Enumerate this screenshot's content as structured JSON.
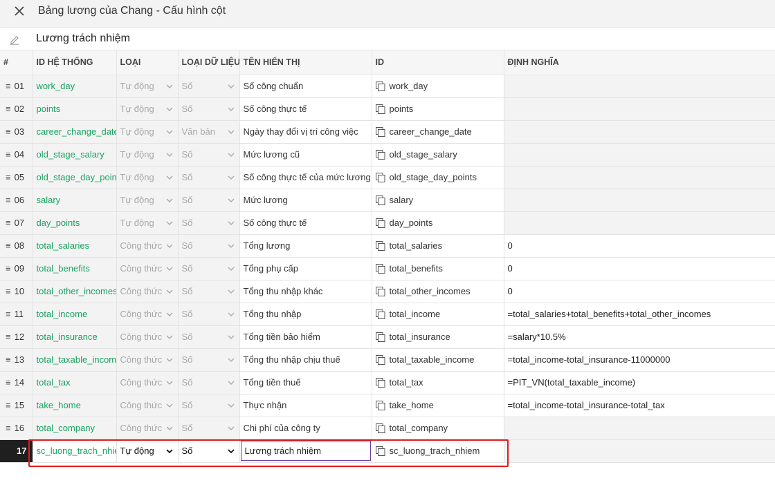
{
  "header": {
    "title": "Bảng lương của Chang - Cấu hình cột",
    "close_icon": "close-icon"
  },
  "name_field": {
    "value": "Lương trách nhiệm",
    "icon": "pencil-icon"
  },
  "columns": {
    "num": "#",
    "system_id": "ID HỆ THỐNG",
    "type": "LOẠI",
    "data_type": "LOẠI DỮ LIỆU",
    "display_name": "TÊN HIỂN THỊ",
    "id": "ID",
    "definition": "ĐỊNH NGHĨA"
  },
  "rows": [
    {
      "num": "01",
      "system_id": "work_day",
      "type": "Tự động",
      "data_type": "Số",
      "display_name": "Số công chuẩn",
      "id": "work_day",
      "definition": ""
    },
    {
      "num": "02",
      "system_id": "points",
      "type": "Tự động",
      "data_type": "Số",
      "display_name": "Số công thực tế",
      "id": "points",
      "definition": ""
    },
    {
      "num": "03",
      "system_id": "career_change_date_",
      "type": "Tự động",
      "data_type": "Văn bản",
      "display_name": "Ngày thay đổi vị trí công việc",
      "id": "career_change_date",
      "definition": ""
    },
    {
      "num": "04",
      "system_id": "old_stage_salary",
      "type": "Tự động",
      "data_type": "Số",
      "display_name": "Mức lương cũ",
      "id": "old_stage_salary",
      "definition": ""
    },
    {
      "num": "05",
      "system_id": "old_stage_day_points",
      "type": "Tự động",
      "data_type": "Số",
      "display_name": "Số công thực tế của mức lương",
      "id": "old_stage_day_points",
      "definition": ""
    },
    {
      "num": "06",
      "system_id": "salary",
      "type": "Tự động",
      "data_type": "Số",
      "display_name": "Mức lương",
      "id": "salary",
      "definition": ""
    },
    {
      "num": "07",
      "system_id": "day_points",
      "type": "Tự động",
      "data_type": "Số",
      "display_name": "Số công thực tế",
      "id": "day_points",
      "definition": ""
    },
    {
      "num": "08",
      "system_id": "total_salaries",
      "type": "Công thức",
      "data_type": "Số",
      "display_name": "Tổng lương",
      "id": "total_salaries",
      "definition": "0"
    },
    {
      "num": "09",
      "system_id": "total_benefits",
      "type": "Công thức",
      "data_type": "Số",
      "display_name": "Tổng phụ cấp",
      "id": "total_benefits",
      "definition": "0"
    },
    {
      "num": "10",
      "system_id": "total_other_incomes",
      "type": "Công thức",
      "data_type": "Số",
      "display_name": "Tổng thu nhập khác",
      "id": "total_other_incomes",
      "definition": "0"
    },
    {
      "num": "11",
      "system_id": "total_income",
      "type": "Công thức",
      "data_type": "Số",
      "display_name": "Tổng thu nhập",
      "id": "total_income",
      "definition": "=total_salaries+total_benefits+total_other_incomes"
    },
    {
      "num": "12",
      "system_id": "total_insurance",
      "type": "Công thức",
      "data_type": "Số",
      "display_name": "Tổng tiền bảo hiểm",
      "id": "total_insurance",
      "definition": "=salary*10.5%"
    },
    {
      "num": "13",
      "system_id": "total_taxable_income",
      "type": "Công thức",
      "data_type": "Số",
      "display_name": "Tổng thu nhập chịu thuế",
      "id": "total_taxable_income",
      "definition": "=total_income-total_insurance-11000000"
    },
    {
      "num": "14",
      "system_id": "total_tax",
      "type": "Công thức",
      "data_type": "Số",
      "display_name": "Tổng tiền thuế",
      "id": "total_tax",
      "definition": "=PIT_VN(total_taxable_income)"
    },
    {
      "num": "15",
      "system_id": "take_home",
      "type": "Công thức",
      "data_type": "Số",
      "display_name": "Thực nhận",
      "id": "take_home",
      "definition": "=total_income-total_insurance-total_tax"
    },
    {
      "num": "16",
      "system_id": "total_company",
      "type": "Công thức",
      "data_type": "Số",
      "display_name": "Chi phí của công ty",
      "id": "total_company",
      "definition": ""
    }
  ],
  "active_row": {
    "num": "17",
    "system_id": "sc_luong_trach_nhiem",
    "type": "Tự động",
    "data_type": "Số",
    "display_name": "Lương trách nhiệm",
    "id": "sc_luong_trach_nhiem",
    "definition": ""
  },
  "colors": {
    "system_id_text": "#1aa260",
    "highlight_border": "#e01b1b",
    "active_input_border": "#6b3fa0",
    "active_num_bg": "#1f1f1f"
  }
}
